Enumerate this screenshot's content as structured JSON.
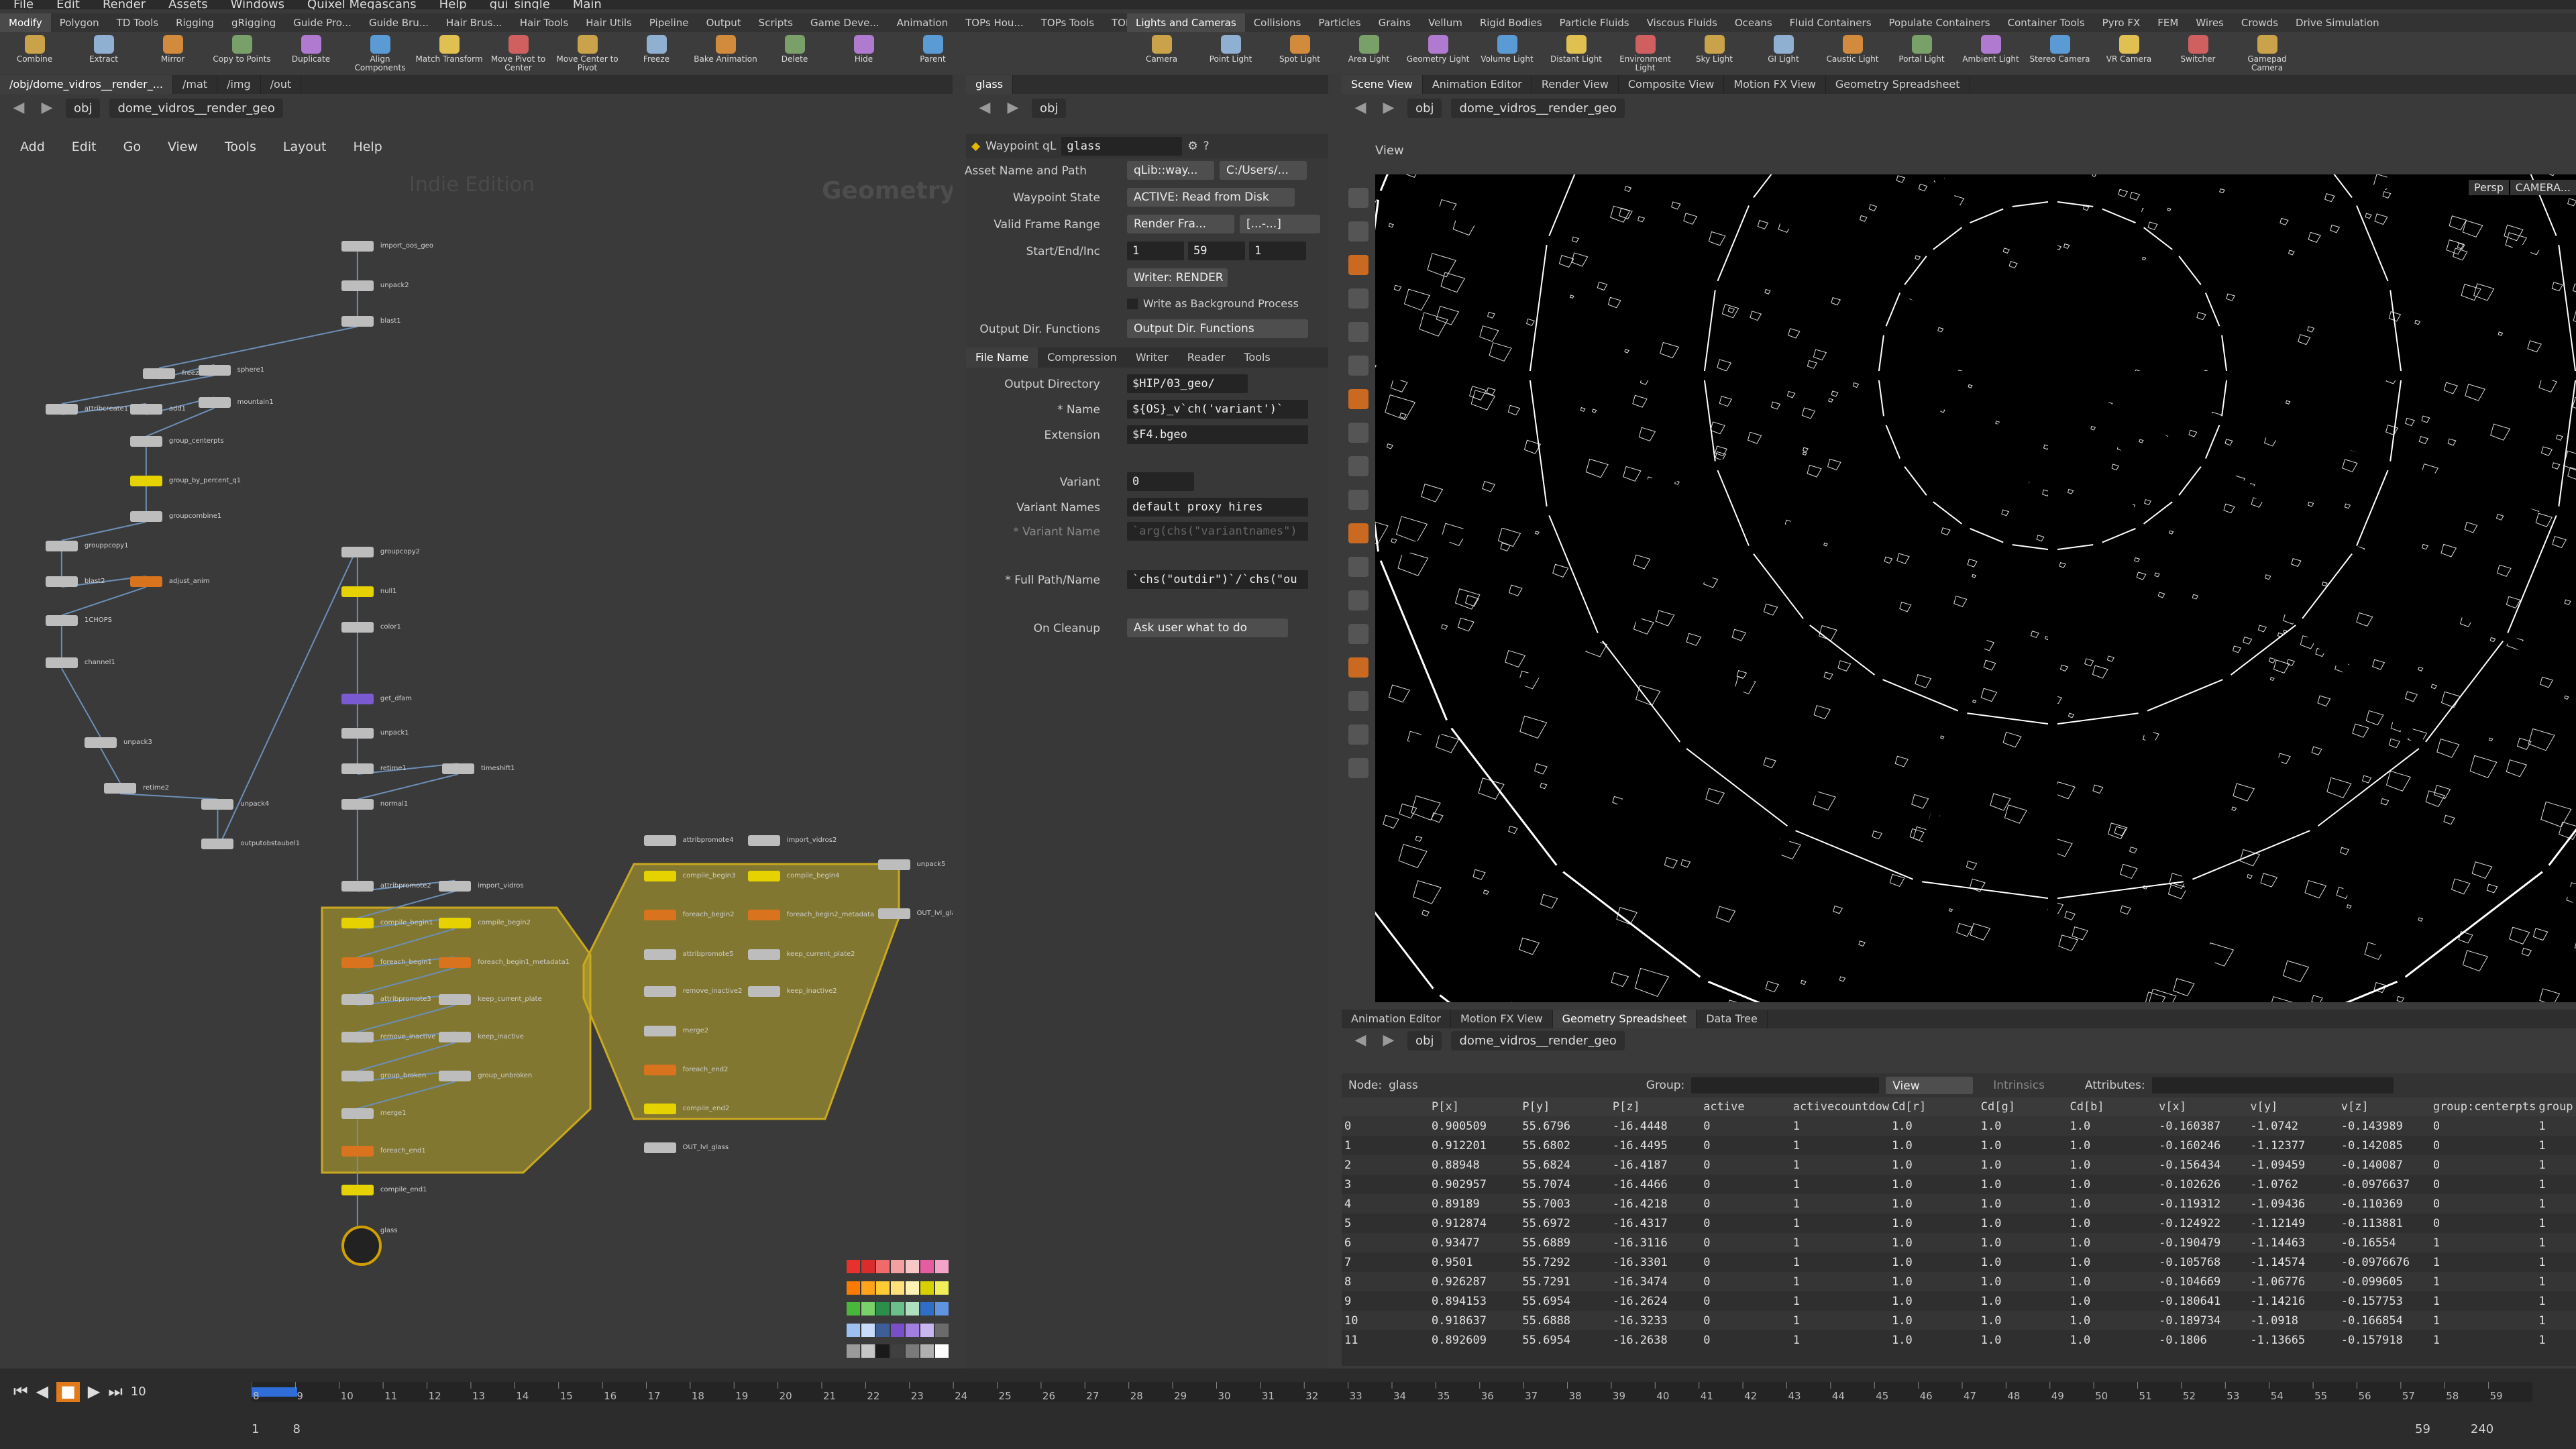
{
  "menubar": [
    "File",
    "Edit",
    "Render",
    "Assets",
    "Windows",
    "Quixel Megascans",
    "Help",
    "gui_single",
    "Main"
  ],
  "shelf_tabs_left": [
    "Modify",
    "Polygon",
    "TD Tools",
    "Rigging",
    "gRigging",
    "Guide Pro...",
    "Guide Bru...",
    "Hair Brus...",
    "Hair Tools",
    "Hair Utils",
    "Pipeline",
    "Output",
    "Scripts",
    "Game Deve...",
    "Animation",
    "TOPs Hou...",
    "TOPs Tools",
    "TOPs Utils"
  ],
  "shelf_tabs_right": [
    "Lights and Cameras",
    "Collisions",
    "Particles",
    "Grains",
    "Vellum",
    "Rigid Bodies",
    "Particle Fluids",
    "Viscous Fluids",
    "Oceans",
    "Fluid Containers",
    "Populate Containers",
    "Container Tools",
    "Pyro FX",
    "FEM",
    "Wires",
    "Crowds",
    "Drive Simulation"
  ],
  "shelf_tools_left": [
    "Combine",
    "Extract",
    "Mirror",
    "Copy to Points",
    "Duplicate",
    "Align Components",
    "Match Transform",
    "Move Pivot to Center",
    "Move Center to Pivot",
    "Freeze",
    "Bake Animation",
    "Delete",
    "Hide",
    "Parent"
  ],
  "shelf_tools_right": [
    "Camera",
    "Point Light",
    "Spot Light",
    "Area Light",
    "Geometry Light",
    "Volume Light",
    "Distant Light",
    "Environment Light",
    "Sky Light",
    "GI Light",
    "Caustic Light",
    "Portal Light",
    "Ambient Light",
    "Stereo Camera",
    "VR Camera",
    "Switcher",
    "Gamepad Camera"
  ],
  "network_pane": {
    "tabs": [
      "/obj/dome_vidros__render_...",
      "/mat",
      "/img",
      "/out"
    ],
    "path": {
      "root": "obj",
      "node": "dome_vidros__render_geo"
    },
    "menu": [
      "Add",
      "Edit",
      "Go",
      "View",
      "Tools",
      "Layout",
      "Help"
    ],
    "watermark_edition": "Indie Edition",
    "watermark_context": "Geometry",
    "nodes": [
      {
        "label": "import_oos_geo",
        "c": "g"
      },
      {
        "label": "unpack2",
        "c": "g"
      },
      {
        "label": "blast1",
        "c": "g"
      },
      {
        "label": "freeze",
        "c": "g"
      },
      {
        "label": "sphere1",
        "c": "g"
      },
      {
        "label": "attribcreate1",
        "c": "g"
      },
      {
        "label": "add1",
        "c": "g"
      },
      {
        "label": "mountain1",
        "c": "g"
      },
      {
        "label": "group_centerpts",
        "c": "g"
      },
      {
        "label": "group_by_percent_q1",
        "c": "y"
      },
      {
        "label": "groupcombine1",
        "c": "g"
      },
      {
        "label": "grouppcopy1",
        "c": "g"
      },
      {
        "label": "blast2",
        "c": "g"
      },
      {
        "label": "adjust_anim",
        "c": "o"
      },
      {
        "label": "1CHOPS",
        "c": "g"
      },
      {
        "label": "channel1",
        "c": "g"
      },
      {
        "label": "unpack3",
        "c": "g"
      },
      {
        "label": "retime2",
        "c": "g"
      },
      {
        "label": "unpack4",
        "c": "g"
      },
      {
        "label": "outputobstaubel1",
        "c": "g"
      },
      {
        "label": "groupcopy2",
        "c": "g"
      },
      {
        "label": "null1",
        "c": "y"
      },
      {
        "label": "color1",
        "c": "g"
      },
      {
        "label": "get_dfam",
        "c": "p"
      },
      {
        "label": "unpack1",
        "c": "g"
      },
      {
        "label": "retime1",
        "c": "g"
      },
      {
        "label": "timeshift1",
        "c": "g"
      },
      {
        "label": "normal1",
        "c": "g"
      },
      {
        "label": "attribpromote2",
        "c": "g"
      },
      {
        "label": "import_vidros",
        "c": "g"
      },
      {
        "label": "compile_begin1",
        "c": "y"
      },
      {
        "label": "compile_begin2",
        "c": "y"
      },
      {
        "label": "foreach_begin1",
        "c": "o"
      },
      {
        "label": "foreach_begin1_metadata1",
        "c": "o"
      },
      {
        "label": "attribpromote3",
        "c": "g"
      },
      {
        "label": "keep_current_plate",
        "c": "g"
      },
      {
        "label": "remove_inactive",
        "c": "g"
      },
      {
        "label": "keep_inactive",
        "c": "g"
      },
      {
        "label": "group_broken",
        "c": "g"
      },
      {
        "label": "group_unbroken",
        "c": "g"
      },
      {
        "label": "merge1",
        "c": "g"
      },
      {
        "label": "foreach_end1",
        "c": "o"
      },
      {
        "label": "compile_end1",
        "c": "y"
      },
      {
        "label": "glass",
        "c": "sel"
      },
      {
        "label": "OUT_lvl_glass",
        "c": "g"
      },
      {
        "label": "attribpromote4",
        "c": "g"
      },
      {
        "label": "import_vidros2",
        "c": "g"
      },
      {
        "label": "unpack5",
        "c": "g"
      },
      {
        "label": "compile_begin3",
        "c": "y"
      },
      {
        "label": "compile_begin4",
        "c": "y"
      },
      {
        "label": "foreach_begin2",
        "c": "o"
      },
      {
        "label": "foreach_begin2_metadata",
        "c": "o"
      },
      {
        "label": "attribpromote5",
        "c": "g"
      },
      {
        "label": "keep_current_plate2",
        "c": "g"
      },
      {
        "label": "remove_inactive2",
        "c": "g"
      },
      {
        "label": "keep_inactive2",
        "c": "g"
      },
      {
        "label": "merge2",
        "c": "g"
      },
      {
        "label": "foreach_end2",
        "c": "o"
      },
      {
        "label": "compile_end2",
        "c": "y"
      },
      {
        "label": "OUT_lvl_glass",
        "c": "g"
      }
    ],
    "palette_colors": [
      "#e8302c",
      "#d92c2c",
      "#f06a6a",
      "#f4a0a0",
      "#f7c7c7",
      "#e65ca0",
      "#f4a3c9",
      "#ff7a00",
      "#ffa31a",
      "#ffcc33",
      "#ffe07a",
      "#fff0b3",
      "#d9d000",
      "#f2ee5a",
      "#48b83a",
      "#7ad169",
      "#2b8f4c",
      "#6ac08a",
      "#aee0c0",
      "#2f6ec8",
      "#5e94e0",
      "#9cc0f0",
      "#c6dcf8",
      "#3e5e9a",
      "#7a4ec8",
      "#a27ee0",
      "#c9b5f0",
      "#6b6b6b",
      "#9a9a9a",
      "#c6c6c6",
      "#1a1a1a",
      "#404040",
      "#7a7a7a",
      "#b0b0b0",
      "#ffffff"
    ]
  },
  "param_pane": {
    "tab": "glass",
    "path": {
      "root": "obj",
      "node": ""
    },
    "node_type": "Waypoint qL",
    "node_name": "glass",
    "asset_name_label": "Asset Name and Path",
    "asset_name_value": "qLib::way...",
    "asset_path_value": "C:/Users/...",
    "waypoint_state_label": "Waypoint State",
    "waypoint_state_value": "ACTIVE: Read from Disk",
    "valid_frame_range_label": "Valid Frame Range",
    "valid_frame_range_value": "Render Fra...",
    "valid_frame_range_extra": "[...-...]",
    "start_end_inc_label": "Start/End/Inc",
    "start": "1",
    "end": "59",
    "inc": "1",
    "writer_button": "Writer: RENDER",
    "background_checkbox": "Write as Background Process",
    "output_dir_functions_label": "Output Dir. Functions",
    "output_dir_functions_value": "Output Dir. Functions",
    "sub_tabs": [
      "File Name",
      "Compression",
      "Writer",
      "Reader",
      "Tools"
    ],
    "output_directory_label": "Output Directory",
    "output_directory_value": "$HIP/03_geo/",
    "name_label": "* Name",
    "name_value": "${OS}_v`ch('variant')`",
    "extension_label": "Extension",
    "extension_value": "$F4.bgeo",
    "variant_label": "Variant",
    "variant_value": "0",
    "variant_names_label": "Variant Names",
    "variant_names_value": "default proxy hires",
    "variant_name_label": "* Variant Name",
    "variant_name_value": "`arg(chs(\"variantnames\")",
    "full_path_label": "* Full Path/Name",
    "full_path_value": "`chs(\"outdir\")`/`chs(\"ou",
    "on_cleanup_label": "On Cleanup",
    "on_cleanup_value": "Ask user what to do"
  },
  "right_top_tabs": [
    "Scene View",
    "Animation Editor",
    "Render View",
    "Composite View",
    "Motion FX View",
    "Geometry Spreadsheet"
  ],
  "viewport": {
    "path": {
      "root": "obj",
      "node": "dome_vidros__render_geo"
    },
    "title": "View",
    "persp": "Persp",
    "camera": "CAMERA..."
  },
  "spreadsheet": {
    "tabs": [
      "Animation Editor",
      "Motion FX View",
      "Geometry Spreadsheet",
      "Data Tree"
    ],
    "path": {
      "root": "obj",
      "node": "dome_vidros__render_geo"
    },
    "node_label": "Node:",
    "node_value": "glass",
    "group_label": "Group:",
    "view_label": "View",
    "intrinsics_label": "Intrinsics",
    "attributes_label": "Attributes:",
    "columns": [
      "",
      "P[x]",
      "P[y]",
      "P[z]",
      "active",
      "activecountdow",
      "Cd[r]",
      "Cd[g]",
      "Cd[b]",
      "v[x]",
      "v[y]",
      "v[z]",
      "group:centerpts",
      "group"
    ],
    "rows": [
      [
        "0",
        "0.900509",
        "55.6796",
        "-16.4448",
        "0",
        "1",
        "1.0",
        "1.0",
        "1.0",
        "-0.160387",
        "-1.0742",
        "-0.143989",
        "0",
        "1"
      ],
      [
        "1",
        "0.912201",
        "55.6802",
        "-16.4495",
        "0",
        "1",
        "1.0",
        "1.0",
        "1.0",
        "-0.160246",
        "-1.12377",
        "-0.142085",
        "0",
        "1"
      ],
      [
        "2",
        "0.88948",
        "55.6824",
        "-16.4187",
        "0",
        "1",
        "1.0",
        "1.0",
        "1.0",
        "-0.156434",
        "-1.09459",
        "-0.140087",
        "0",
        "1"
      ],
      [
        "3",
        "0.902957",
        "55.7074",
        "-16.4466",
        "0",
        "1",
        "1.0",
        "1.0",
        "1.0",
        "-0.102626",
        "-1.0762",
        "-0.0976637",
        "0",
        "1"
      ],
      [
        "4",
        "0.89189",
        "55.7003",
        "-16.4218",
        "0",
        "1",
        "1.0",
        "1.0",
        "1.0",
        "-0.119312",
        "-1.09436",
        "-0.110369",
        "0",
        "1"
      ],
      [
        "5",
        "0.912874",
        "55.6972",
        "-16.4317",
        "0",
        "1",
        "1.0",
        "1.0",
        "1.0",
        "-0.124922",
        "-1.12149",
        "-0.113881",
        "0",
        "1"
      ],
      [
        "6",
        "0.93477",
        "55.6889",
        "-16.3116",
        "0",
        "1",
        "1.0",
        "1.0",
        "1.0",
        "-0.190479",
        "-1.14463",
        "-0.16554",
        "1",
        "1"
      ],
      [
        "7",
        "0.9501",
        "55.7292",
        "-16.3301",
        "0",
        "1",
        "1.0",
        "1.0",
        "1.0",
        "-0.105768",
        "-1.14574",
        "-0.0976676",
        "1",
        "1"
      ],
      [
        "8",
        "0.926287",
        "55.7291",
        "-16.3474",
        "0",
        "1",
        "1.0",
        "1.0",
        "1.0",
        "-0.104669",
        "-1.06776",
        "-0.099605",
        "1",
        "1"
      ],
      [
        "9",
        "0.894153",
        "55.6954",
        "-16.2624",
        "0",
        "1",
        "1.0",
        "1.0",
        "1.0",
        "-0.180641",
        "-1.14216",
        "-0.157753",
        "1",
        "1"
      ],
      [
        "10",
        "0.918637",
        "55.6888",
        "-16.3233",
        "0",
        "1",
        "1.0",
        "1.0",
        "1.0",
        "-0.189734",
        "-1.0918",
        "-0.166854",
        "1",
        "1"
      ],
      [
        "11",
        "0.892609",
        "55.6954",
        "-16.2638",
        "0",
        "1",
        "1.0",
        "1.0",
        "1.0",
        "-0.1806",
        "-1.13665",
        "-0.157918",
        "1",
        "1"
      ]
    ]
  },
  "timeline": {
    "current_frame": "10",
    "ticks": [
      "8",
      "9",
      "10",
      "11",
      "12",
      "13",
      "14",
      "15",
      "16",
      "17",
      "18",
      "19",
      "20",
      "21",
      "22",
      "23",
      "24",
      "25",
      "26",
      "27",
      "28",
      "29",
      "30",
      "31",
      "32",
      "33",
      "34",
      "35",
      "36",
      "37",
      "38",
      "39",
      "40",
      "41",
      "42",
      "43",
      "44",
      "45",
      "46",
      "47",
      "48",
      "49",
      "50",
      "51",
      "52",
      "53",
      "54",
      "55",
      "56",
      "57",
      "58",
      "59"
    ],
    "range_start": "1",
    "range_start2": "8",
    "range_end": "59",
    "range_end2": "240"
  }
}
